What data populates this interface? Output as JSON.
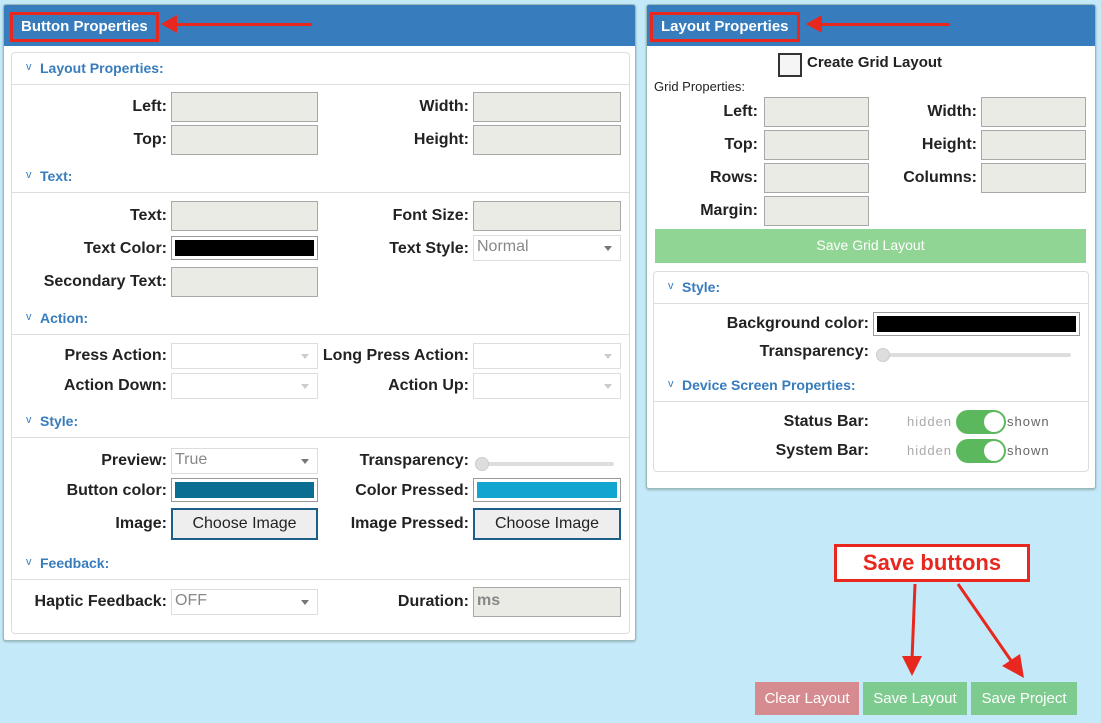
{
  "button_panel": {
    "title": "Button Properties",
    "sections": {
      "layout": "Layout Properties:",
      "text": "Text:",
      "action": "Action:",
      "style": "Style:",
      "feedback": "Feedback:"
    },
    "labels": {
      "left": "Left:",
      "width": "Width:",
      "top": "Top:",
      "height": "Height:",
      "text": "Text:",
      "font_size": "Font Size:",
      "text_color": "Text Color:",
      "text_style": "Text Style:",
      "secondary_text": "Secondary Text:",
      "press_action": "Press Action:",
      "long_press_action": "Long Press Action:",
      "action_down": "Action Down:",
      "action_up": "Action Up:",
      "preview": "Preview:",
      "transparency": "Transparency:",
      "button_color": "Button color:",
      "color_pressed": "Color Pressed:",
      "image": "Image:",
      "image_pressed": "Image Pressed:",
      "haptic_feedback": "Haptic Feedback:",
      "duration": "Duration:"
    },
    "values": {
      "text_style": "Normal",
      "preview": "True",
      "haptic_feedback": "OFF",
      "duration_placeholder": "ms",
      "choose_image": "Choose Image",
      "choose_image_pressed": "Choose Image"
    },
    "colors": {
      "text_color": "#000000",
      "button_color": "#0a6e93",
      "color_pressed": "#11a5cf"
    }
  },
  "layout_panel": {
    "title": "Layout Properties",
    "create_grid_label": "Create Grid Layout",
    "grid_properties_label": "Grid Properties:",
    "labels": {
      "left": "Left:",
      "width": "Width:",
      "top": "Top:",
      "height": "Height:",
      "rows": "Rows:",
      "columns": "Columns:",
      "margin": "Margin:"
    },
    "save_grid_label": "Save Grid Layout",
    "style_section": "Style:",
    "background_color_label": "Background color:",
    "background_color": "#000000",
    "transparency_label": "Transparency:",
    "device_section": "Device Screen Properties:",
    "status_bar_label": "Status Bar:",
    "system_bar_label": "System Bar:",
    "toggle_off_text": "hidden",
    "toggle_on_text": "shown"
  },
  "footer": {
    "clear_layout": "Clear Layout",
    "save_layout": "Save Layout",
    "save_project": "Save Project"
  },
  "annotation": {
    "callout": "Save buttons"
  }
}
